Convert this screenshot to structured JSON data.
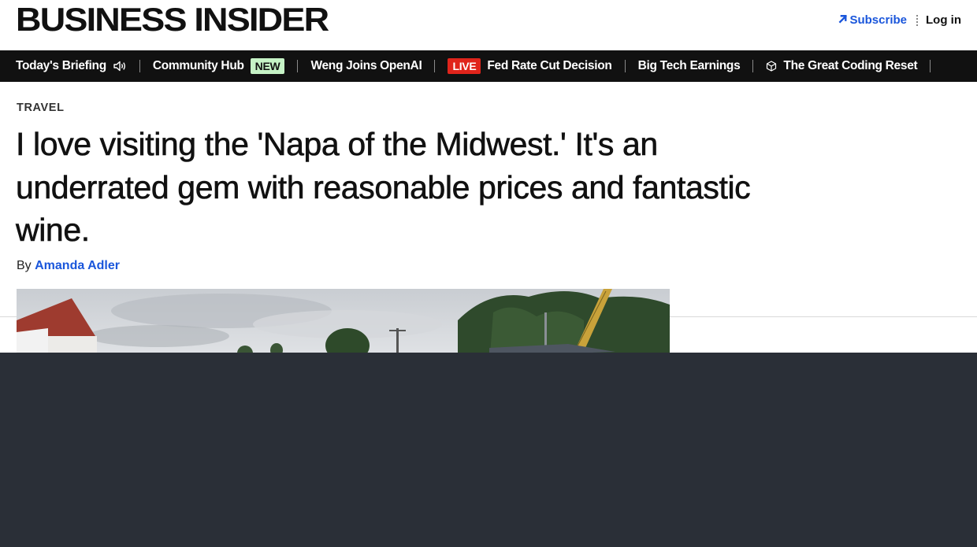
{
  "header": {
    "logo_text": "BUSINESS INSIDER",
    "subscribe_label": "Subscribe",
    "login_label": "Log in",
    "accent_color": "#1a56db"
  },
  "ticker": {
    "items": [
      {
        "label": "Today's Briefing",
        "icon": "speaker-icon"
      },
      {
        "label": "Community Hub",
        "badge": "NEW"
      },
      {
        "label": "Weng Joins OpenAI"
      },
      {
        "label": "Fed Rate Cut Decision",
        "badge": "LIVE"
      },
      {
        "label": "Big Tech Earnings"
      },
      {
        "label": "The Great Coding Reset",
        "icon": "cube-icon"
      }
    ],
    "live_color": "#e0241b",
    "new_color": "#c6f3c6"
  },
  "article": {
    "category": "TRAVEL",
    "headline": "I love visiting the 'Napa of the Midwest.' It's an underrated gem with reasonable prices and fantastic wine.",
    "byline_prefix": "By",
    "author": "Amanda Adler"
  },
  "overlay": {
    "color": "#2a2f37"
  }
}
